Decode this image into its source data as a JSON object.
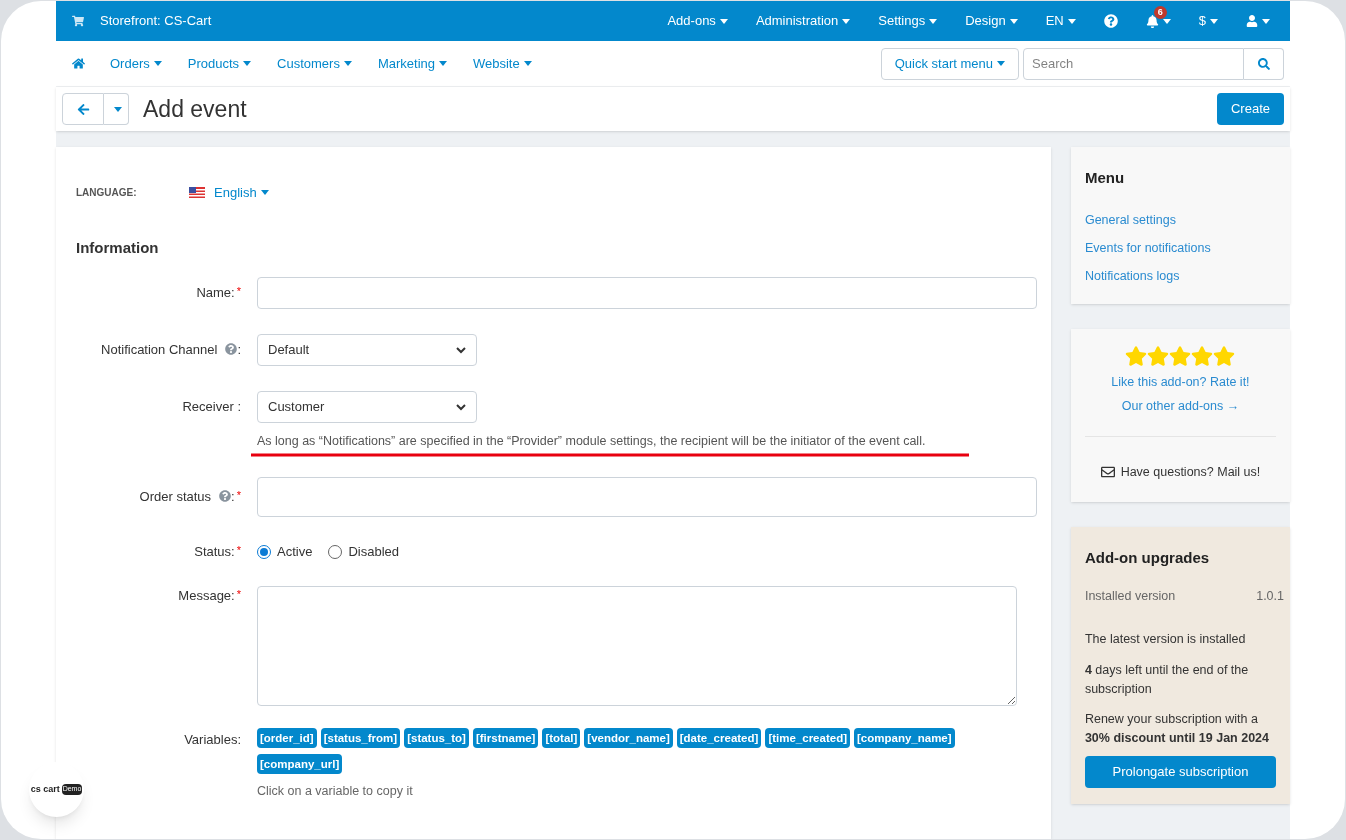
{
  "top_bar": {
    "storefront": "Storefront: CS-Cart",
    "menus": [
      {
        "label": "Add-ons",
        "kind": "dropdown"
      },
      {
        "label": "Administration",
        "kind": "dropdown"
      },
      {
        "label": "Settings",
        "kind": "dropdown"
      },
      {
        "label": "Design",
        "kind": "dropdown"
      },
      {
        "label": "EN",
        "kind": "dropdown"
      },
      {
        "kind": "help"
      },
      {
        "kind": "bell",
        "badge": "6"
      },
      {
        "label": "$",
        "kind": "dropdown"
      },
      {
        "kind": "user"
      }
    ]
  },
  "nav": {
    "items": [
      "Orders",
      "Products",
      "Customers",
      "Marketing",
      "Website"
    ],
    "quick_start": "Quick start menu",
    "search": {
      "placeholder": "Search"
    }
  },
  "title_bar": {
    "title": "Add event",
    "create": "Create"
  },
  "form": {
    "required_mark": "*",
    "help_suffix": ":",
    "language_label": "LANGUAGE:",
    "language": "English",
    "section": "Information",
    "fields": [
      {
        "kind": "text",
        "label": "Name:",
        "required": true,
        "help": false
      },
      {
        "kind": "select",
        "label": "Notification Channel",
        "required": false,
        "help": true,
        "value": "Default"
      },
      {
        "kind": "select",
        "label": "Receiver :",
        "required": false,
        "help": false,
        "value": "Customer",
        "note": "As long as “Notifications” are specified in the “Provider” module settings, the recipient will be the initiator of the event call."
      },
      {
        "kind": "tall",
        "label": "Order status",
        "required": true,
        "help": true
      },
      {
        "kind": "radio",
        "label": "Status:",
        "required": true,
        "help": false,
        "options": [
          {
            "label": "Active",
            "selected": true
          },
          {
            "label": "Disabled",
            "selected": false
          }
        ]
      },
      {
        "kind": "textarea",
        "label": "Message:",
        "required": true,
        "help": false
      },
      {
        "kind": "variables",
        "label": "Variables:",
        "required": false,
        "help": false,
        "tags": [
          "[order_id]",
          "[status_from]",
          "[status_to]",
          "[firstname]",
          "[total]",
          "[vendor_name]",
          "[date_created]",
          "[time_created]",
          "[company_name]",
          "[company_url]"
        ],
        "hint": "Click on a variable to copy it"
      }
    ]
  },
  "sidebar": {
    "menu": {
      "title": "Menu",
      "links": [
        "General settings",
        "Events for notifications",
        "Notifications logs"
      ]
    },
    "rating": {
      "stars": 5,
      "rate": "Like this add-on? Rate it!",
      "other": "Our other add-ons →",
      "mail": "Have questions? Mail us!"
    },
    "upgrades": {
      "title": "Add-on upgrades",
      "installed_label": "Installed version",
      "installed_value": "1.0.1",
      "latest": "The latest version is installed",
      "days": "**4** days left until the end of the subscription",
      "renew": "Renew your subscription with a **30% discount until 19 Jan 2024**",
      "button": "Prolongate subscription"
    }
  },
  "widget": {
    "logo": "cs cart",
    "badge": "Demo"
  }
}
